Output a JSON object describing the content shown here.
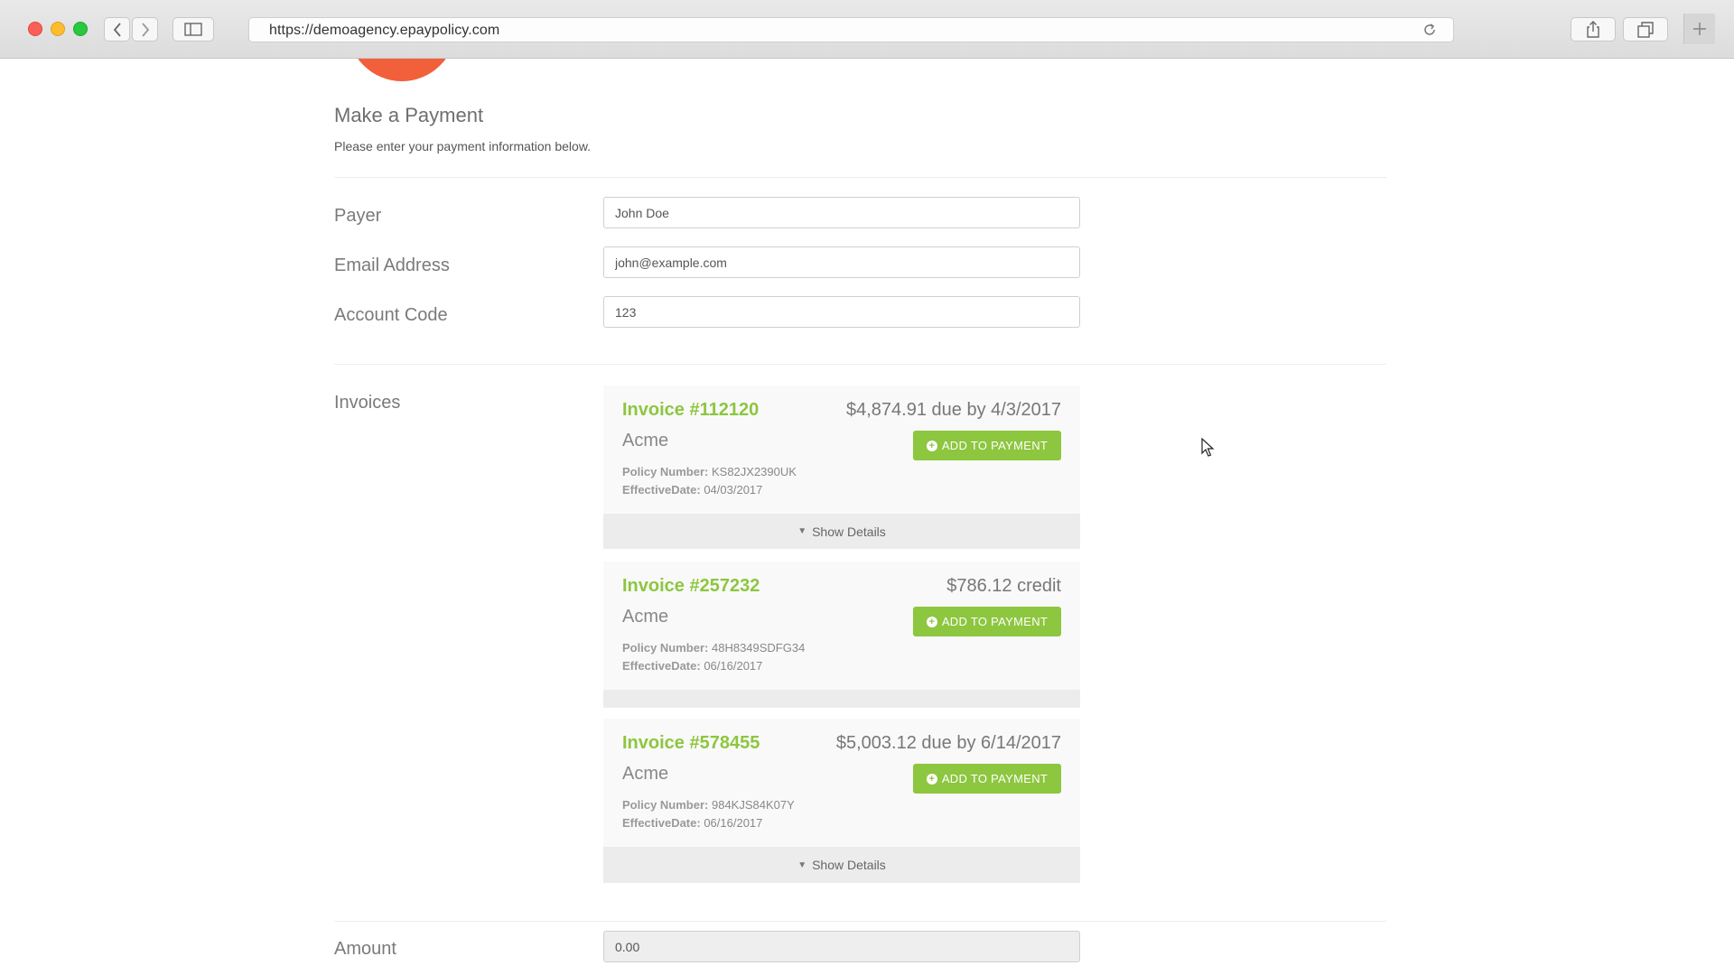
{
  "browser": {
    "url": "https://demoagency.epaypolicy.com"
  },
  "page": {
    "title": "Make a Payment",
    "subtitle": "Please enter your payment information below."
  },
  "form": {
    "payer": {
      "label": "Payer",
      "value": "John Doe"
    },
    "email": {
      "label": "Email Address",
      "value": "john@example.com"
    },
    "account_code": {
      "label": "Account Code",
      "value": "123"
    },
    "invoices_label": "Invoices",
    "amount": {
      "label": "Amount",
      "value": "0.00"
    }
  },
  "invoices": [
    {
      "number": "Invoice #112120",
      "amount": "$4,874.91 due by 4/3/2017",
      "company": "Acme",
      "policy_label": "Policy Number:",
      "policy_number": "KS82JX2390UK",
      "effective_label": "EffectiveDate:",
      "effective_date": "04/03/2017",
      "button_label": "ADD TO PAYMENT",
      "details_label": "Show Details"
    },
    {
      "number": "Invoice #257232",
      "amount": "$786.12 credit",
      "company": "Acme",
      "policy_label": "Policy Number:",
      "policy_number": "48H8349SDFG34",
      "effective_label": "EffectiveDate:",
      "effective_date": "06/16/2017",
      "button_label": "ADD TO PAYMENT"
    },
    {
      "number": "Invoice #578455",
      "amount": "$5,003.12 due by 6/14/2017",
      "company": "Acme",
      "policy_label": "Policy Number:",
      "policy_number": "984KJS84K07Y",
      "effective_label": "EffectiveDate:",
      "effective_date": "06/16/2017",
      "button_label": "ADD TO PAYMENT",
      "details_label": "Show Details"
    }
  ],
  "colors": {
    "accent_green": "#8dc63f",
    "logo_orange": "#f25f3b"
  }
}
